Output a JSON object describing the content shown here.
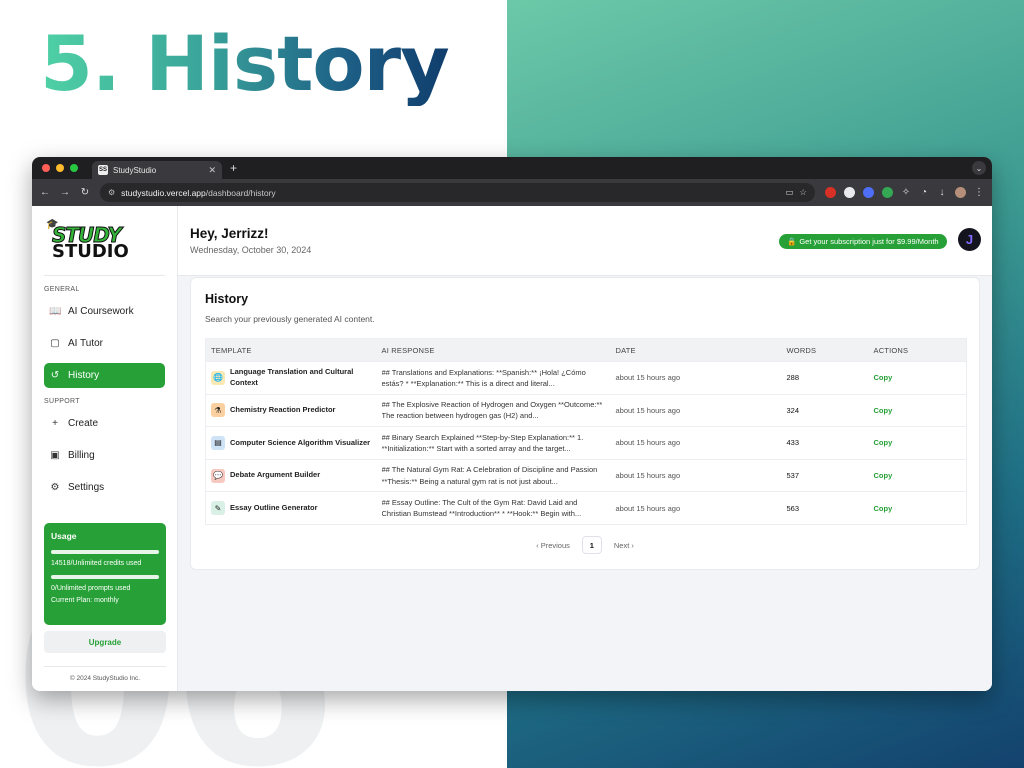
{
  "slide": {
    "title": "5. History",
    "number": "06"
  },
  "browser": {
    "tab_title": "StudyStudio",
    "tab_favicon": "SS",
    "url_host": "studystudio.vercel.app",
    "url_path": "/dashboard/history"
  },
  "sidebar": {
    "logo_line1": "STUDY",
    "logo_line2": "STUDIO",
    "general_label": "GENERAL",
    "general_items": [
      {
        "label": "AI Coursework",
        "icon": "book-icon"
      },
      {
        "label": "AI Tutor",
        "icon": "chat-icon"
      },
      {
        "label": "History",
        "icon": "history-icon",
        "active": true
      }
    ],
    "support_label": "SUPPORT",
    "support_items": [
      {
        "label": "Create",
        "icon": "plus-icon"
      },
      {
        "label": "Billing",
        "icon": "wallet-icon"
      },
      {
        "label": "Settings",
        "icon": "gear-icon"
      }
    ],
    "usage": {
      "title": "Usage",
      "credits_text": "14518/Unlimited credits used",
      "prompts_text": "0/Unlimited prompts used",
      "plan_text": "Current Plan: monthly"
    },
    "upgrade_label": "Upgrade",
    "footer": "© 2024 StudyStudio Inc."
  },
  "header": {
    "greeting": "Hey, Jerrizz!",
    "date": "Wednesday, October 30, 2024",
    "promo": "Get your subscription just for $9.99/Month",
    "avatar_initial": "J"
  },
  "history": {
    "title": "History",
    "subtitle": "Search your previously generated AI content.",
    "columns": [
      "TEMPLATE",
      "AI RESPONSE",
      "DATE",
      "WORDS",
      "ACTIONS"
    ],
    "rows": [
      {
        "template": "Language Translation and Cultural Context",
        "response": "## Translations and Explanations: **Spanish:** ¡Hola! ¿Cómo estás? * **Explanation:** This is a direct and literal...",
        "date": "about 15 hours ago",
        "words": "288",
        "action": "Copy"
      },
      {
        "template": "Chemistry Reaction Predictor",
        "response": "## The Explosive Reaction of Hydrogen and Oxygen **Outcome:** The reaction between hydrogen gas (H2) and...",
        "date": "about 15 hours ago",
        "words": "324",
        "action": "Copy"
      },
      {
        "template": "Computer Science Algorithm Visualizer",
        "response": "## Binary Search Explained **Step-by-Step Explanation:** 1. **Initialization:** Start with a sorted array and the target...",
        "date": "about 15 hours ago",
        "words": "433",
        "action": "Copy"
      },
      {
        "template": "Debate Argument Builder",
        "response": "## The Natural Gym Rat: A Celebration of Discipline and Passion **Thesis:** Being a natural gym rat is not just about...",
        "date": "about 15 hours ago",
        "words": "537",
        "action": "Copy"
      },
      {
        "template": "Essay Outline Generator",
        "response": "## Essay Outline: The Cult of the Gym Rat: David Laid and Christian Bumstead **Introduction** * **Hook:** Begin with...",
        "date": "about 15 hours ago",
        "words": "563",
        "action": "Copy"
      }
    ],
    "pager": {
      "previous": "Previous",
      "page": "1",
      "next": "Next"
    }
  }
}
